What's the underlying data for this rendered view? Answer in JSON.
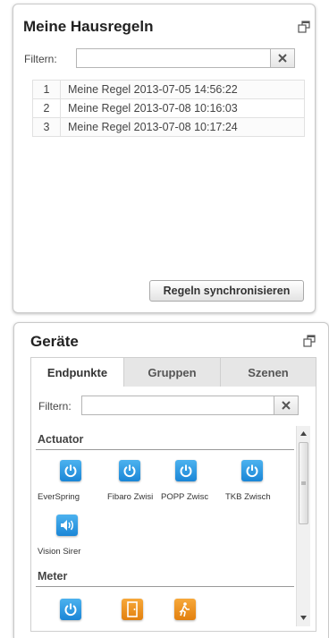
{
  "rules_panel": {
    "title": "Meine Hausregeln",
    "filter_label": "Filtern:",
    "filter_value": "",
    "rules": [
      {
        "num": "1",
        "name": "Meine Regel 2013-07-05 14:56:22"
      },
      {
        "num": "2",
        "name": "Meine Regel 2013-07-08 10:16:03"
      },
      {
        "num": "3",
        "name": "Meine Regel 2013-07-08 10:17:24"
      }
    ],
    "sync_button": "Regeln synchronisieren"
  },
  "devices_panel": {
    "title": "Geräte",
    "tabs": [
      "Endpunkte",
      "Gruppen",
      "Szenen"
    ],
    "active_tab": "Endpunkte",
    "filter_label": "Filtern:",
    "filter_value": "",
    "sections": {
      "actuator": "Actuator",
      "meter": "Meter"
    },
    "actuators": [
      {
        "label": "EverSpring",
        "icon": "power-icon",
        "color": "#2a95e0"
      },
      {
        "label": "Fibaro Zwisi",
        "icon": "power-icon",
        "color": "#2a95e0"
      },
      {
        "label": "POPP Zwisc",
        "icon": "power-icon",
        "color": "#2a95e0"
      },
      {
        "label": "TKB Zwisch",
        "icon": "power-icon",
        "color": "#2a95e0"
      },
      {
        "label": "Vision Sirer",
        "icon": "speaker-icon",
        "color": "#2a95e0"
      }
    ],
    "meters": [
      {
        "icon": "power-icon",
        "color": "#2a95e0"
      },
      {
        "icon": "door-icon",
        "color": "#ef9322"
      },
      {
        "icon": "motion-icon",
        "color": "#ef9322"
      }
    ]
  }
}
